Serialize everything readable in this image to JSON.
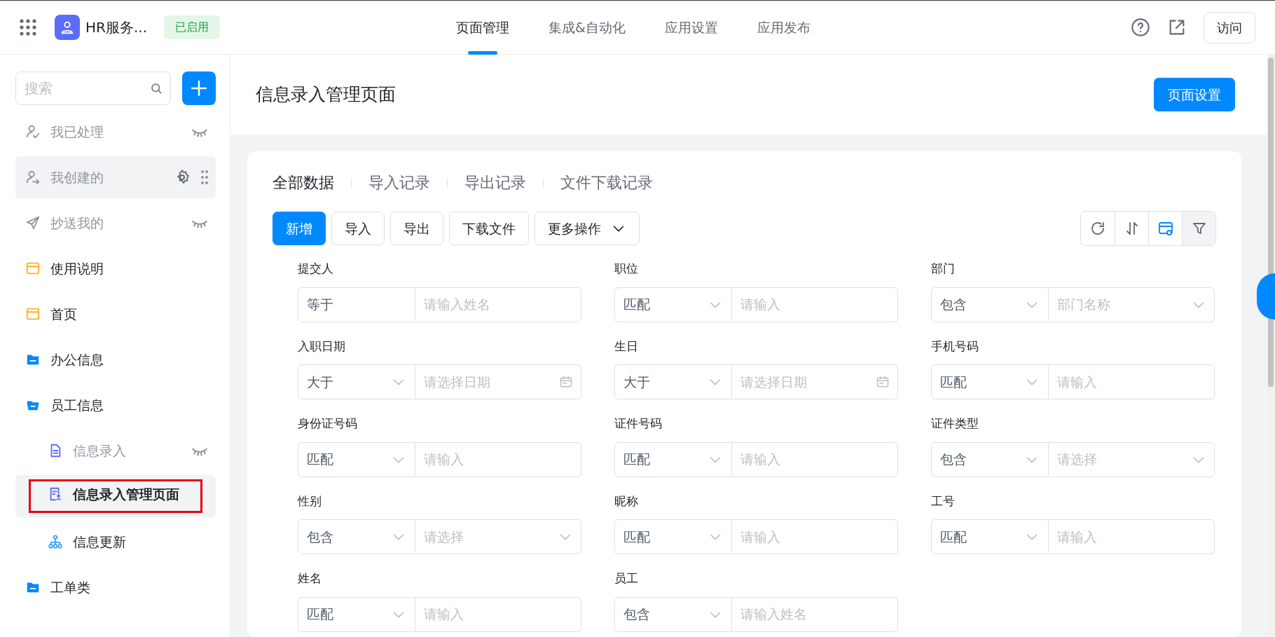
{
  "app": {
    "name": "HR服务...",
    "status": "已启用"
  },
  "top_nav": [
    {
      "label": "页面管理",
      "selected": true
    },
    {
      "label": "集成&自动化",
      "selected": false
    },
    {
      "label": "应用设置",
      "selected": false
    },
    {
      "label": "应用发布",
      "selected": false
    }
  ],
  "visit_button": "访问",
  "sidebar": {
    "search": {
      "placeholder": "搜索"
    },
    "items": [
      {
        "label": "我已处理",
        "kind": "processed",
        "hidden": true,
        "hovered": false,
        "selected": false,
        "highlighted": false
      },
      {
        "label": "我创建的",
        "kind": "created",
        "hidden": false,
        "hovered": true,
        "selected": false,
        "highlighted": false
      },
      {
        "label": "抄送我的",
        "kind": "cc",
        "hidden": true,
        "hovered": false,
        "selected": false,
        "highlighted": false
      },
      {
        "label": "使用说明",
        "kind": "page",
        "hidden": false,
        "hovered": false,
        "selected": false,
        "highlighted": false
      },
      {
        "label": "首页",
        "kind": "page",
        "hidden": false,
        "hovered": false,
        "selected": false,
        "highlighted": false
      },
      {
        "label": "办公信息",
        "kind": "folder",
        "expanded": false,
        "hidden": false,
        "hovered": false,
        "selected": false,
        "highlighted": false
      },
      {
        "label": "员工信息",
        "kind": "folder",
        "expanded": true,
        "hidden": false,
        "hovered": false,
        "selected": false,
        "highlighted": false,
        "children": [
          {
            "label": "信息录入",
            "kind": "form",
            "hidden": true,
            "hovered": false,
            "selected": false,
            "highlighted": false
          },
          {
            "label": "信息录入管理页面",
            "kind": "report",
            "hidden": false,
            "hovered": false,
            "selected": true,
            "highlighted": true
          },
          {
            "label": "信息更新",
            "kind": "flow",
            "hidden": false,
            "hovered": false,
            "selected": false,
            "highlighted": false
          }
        ]
      },
      {
        "label": "工单类",
        "kind": "folder",
        "expanded": false,
        "hidden": false,
        "hovered": false,
        "selected": false,
        "highlighted": false
      }
    ]
  },
  "page": {
    "title": "信息录入管理页面",
    "settings_button": "页面设置"
  },
  "data_tabs": [
    {
      "label": "全部数据",
      "selected": true
    },
    {
      "label": "导入记录",
      "selected": false
    },
    {
      "label": "导出记录",
      "selected": false
    },
    {
      "label": "文件下载记录",
      "selected": false
    }
  ],
  "actions": [
    {
      "label": "新增",
      "kind": "primary"
    },
    {
      "label": "导入",
      "kind": "default"
    },
    {
      "label": "导出",
      "kind": "default"
    },
    {
      "label": "下载文件",
      "kind": "default"
    },
    {
      "label": "更多操作",
      "kind": "dropdown"
    }
  ],
  "tools": [
    {
      "kind": "refresh",
      "active": false
    },
    {
      "kind": "sort",
      "active": false
    },
    {
      "kind": "columns",
      "active": false
    },
    {
      "kind": "filter",
      "active": true
    }
  ],
  "filters": [
    {
      "label": "提交人",
      "operator": "等于",
      "operator_dropdown": false,
      "placeholder": "请输入姓名",
      "kind": "text"
    },
    {
      "label": "职位",
      "operator": "匹配",
      "operator_dropdown": true,
      "placeholder": "请输入",
      "kind": "text"
    },
    {
      "label": "部门",
      "operator": "包含",
      "operator_dropdown": true,
      "placeholder": "部门名称",
      "kind": "select"
    },
    {
      "label": "入职日期",
      "operator": "大于",
      "operator_dropdown": true,
      "placeholder": "请选择日期",
      "kind": "date"
    },
    {
      "label": "生日",
      "operator": "大于",
      "operator_dropdown": true,
      "placeholder": "请选择日期",
      "kind": "date"
    },
    {
      "label": "手机号码",
      "operator": "匹配",
      "operator_dropdown": true,
      "placeholder": "请输入",
      "kind": "text"
    },
    {
      "label": "身份证号码",
      "operator": "匹配",
      "operator_dropdown": true,
      "placeholder": "请输入",
      "kind": "text"
    },
    {
      "label": "证件号码",
      "operator": "匹配",
      "operator_dropdown": true,
      "placeholder": "请输入",
      "kind": "text"
    },
    {
      "label": "证件类型",
      "operator": "包含",
      "operator_dropdown": true,
      "placeholder": "请选择",
      "kind": "select"
    },
    {
      "label": "性别",
      "operator": "包含",
      "operator_dropdown": true,
      "placeholder": "请选择",
      "kind": "select"
    },
    {
      "label": "昵称",
      "operator": "匹配",
      "operator_dropdown": true,
      "placeholder": "请输入",
      "kind": "text"
    },
    {
      "label": "工号",
      "operator": "匹配",
      "operator_dropdown": true,
      "placeholder": "请输入",
      "kind": "text"
    },
    {
      "label": "姓名",
      "operator": "匹配",
      "operator_dropdown": true,
      "placeholder": "请输入",
      "kind": "text"
    },
    {
      "label": "员工",
      "operator": "包含",
      "operator_dropdown": true,
      "placeholder": "请输入姓名",
      "kind": "text"
    }
  ]
}
